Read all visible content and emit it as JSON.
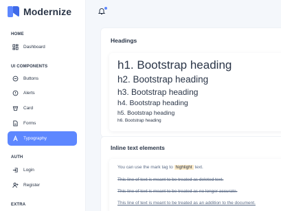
{
  "app": {
    "name": "Modernize"
  },
  "sidebar": {
    "sections": [
      {
        "title": "HOME"
      },
      {
        "title": "UI COMPONENTS"
      },
      {
        "title": "AUTH"
      },
      {
        "title": "EXTRA"
      }
    ],
    "items": [
      {
        "label": "Dashboard",
        "icon": "layout-dashboard-icon"
      },
      {
        "label": "Buttons",
        "icon": "button-icon"
      },
      {
        "label": "Alerts",
        "icon": "alert-circle-icon"
      },
      {
        "label": "Card",
        "icon": "cards-icon"
      },
      {
        "label": "Forms",
        "icon": "file-description-icon"
      },
      {
        "label": "Typography",
        "icon": "typography-icon",
        "active": true
      },
      {
        "label": "Login",
        "icon": "login-icon"
      },
      {
        "label": "Register",
        "icon": "user-plus-icon"
      }
    ]
  },
  "headings_card": {
    "title": "Headings",
    "items": [
      "h1. Bootstrap heading",
      "h2. Bootstrap heading",
      "h3. Bootstrap heading",
      "h4. Bootstrap heading",
      "h5. Bootstrap heading",
      "h6. Bootstrap heading"
    ]
  },
  "inline_card": {
    "title": "Inline text elements",
    "mark_prefix": "You can use the mark tag to ",
    "mark_word": "highlight",
    "mark_suffix": " text.",
    "del_line": "This line of text is meant to be treated as deleted text.",
    "s_line": "This line of text is meant to be treated as no longer accurate.",
    "ins_line": "This line of text is meant to be treated as an addition to the document."
  },
  "colors": {
    "accent": "#5d87ff",
    "text": "#2a3547",
    "muted": "#5a6a85",
    "highlight": "#fdebc8"
  }
}
